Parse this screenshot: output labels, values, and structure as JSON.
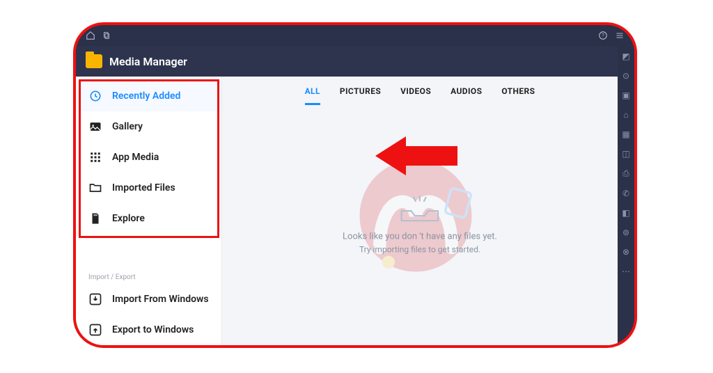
{
  "app": {
    "title": "Media Manager"
  },
  "sidebar": {
    "items": [
      {
        "id": "recently-added",
        "label": "Recently Added",
        "active": true
      },
      {
        "id": "gallery",
        "label": "Gallery"
      },
      {
        "id": "app-media",
        "label": "App Media"
      },
      {
        "id": "imported-files",
        "label": "Imported Files"
      },
      {
        "id": "explore",
        "label": "Explore"
      }
    ],
    "io_section_label": "Import / Export",
    "io_items": [
      {
        "id": "import-win",
        "label": "Import From Windows"
      },
      {
        "id": "export-win",
        "label": "Export to Windows"
      }
    ]
  },
  "tabs": [
    {
      "id": "all",
      "label": "ALL",
      "active": true
    },
    {
      "id": "pictures",
      "label": "PICTURES"
    },
    {
      "id": "videos",
      "label": "VIDEOS"
    },
    {
      "id": "audios",
      "label": "AUDIOS"
    },
    {
      "id": "others",
      "label": "OTHERS"
    }
  ],
  "empty_state": {
    "line1": "Looks like you don 't have any files yet.",
    "line2": "Try importing files to get started."
  }
}
